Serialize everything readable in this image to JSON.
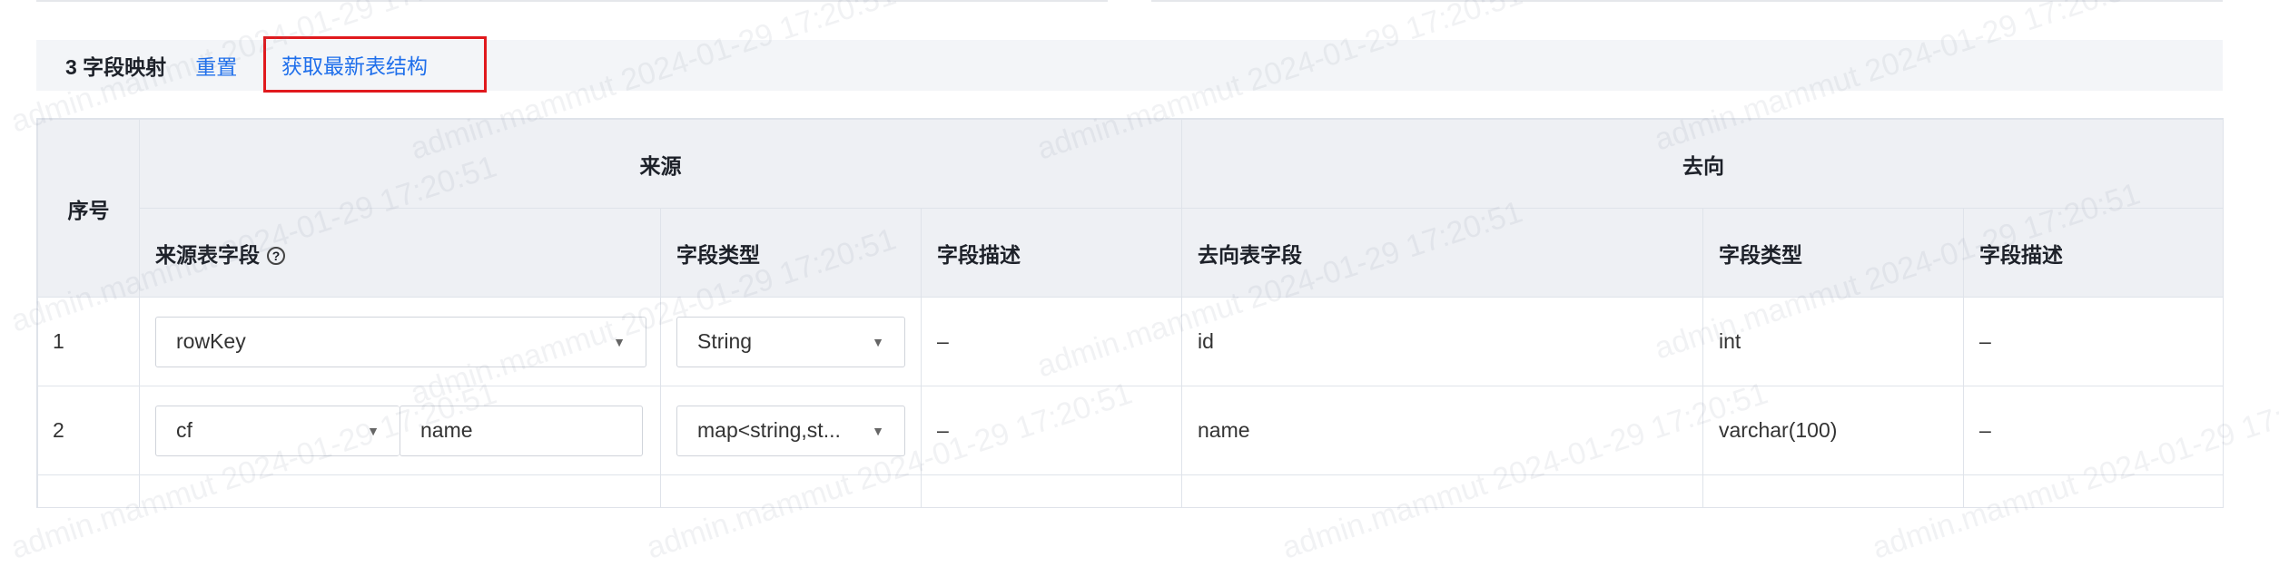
{
  "section": {
    "title": "3 字段映射",
    "reset_label": "重置",
    "fetch_label": "获取最新表结构"
  },
  "table": {
    "index_header": "序号",
    "source_header": "来源",
    "target_header": "去向",
    "columns": {
      "source_field": "来源表字段",
      "source_type": "字段类型",
      "source_desc": "字段描述",
      "target_field": "去向表字段",
      "target_type": "字段类型",
      "target_desc": "字段描述"
    },
    "rows": [
      {
        "index": "1",
        "source_field": "rowKey",
        "source_type": "String",
        "source_desc": "–",
        "target_field": "id",
        "target_type": "int",
        "target_desc": "–"
      },
      {
        "index": "2",
        "source_cf": "cf",
        "source_name": "name",
        "source_type": "map<string,st...",
        "source_desc": "–",
        "target_field": "name",
        "target_type": "varchar(100)",
        "target_desc": "–"
      }
    ]
  },
  "watermark": "admin.mammut 2024-01-29 17:20:51",
  "icons": {
    "help": "question-circle-icon",
    "dropdown": "caret-down-icon"
  }
}
